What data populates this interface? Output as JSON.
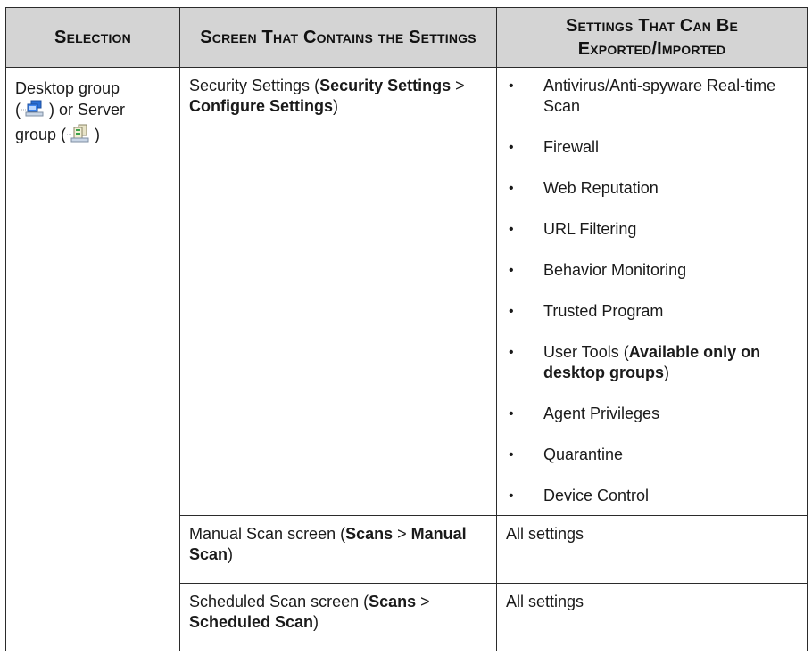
{
  "table": {
    "headers": [
      "Selection",
      "Screen That Contains the Settings",
      "Settings That Can Be Exported/Imported"
    ],
    "selection": {
      "desktop_text": "Desktop group",
      "desktop_icon": "desktop-group-icon",
      "or_server_text": ") or Server",
      "server_text": "group (",
      "server_icon": "server-group-icon",
      "close_paren": ")"
    },
    "rows": [
      {
        "screen": {
          "plain1": "Security Settings (",
          "bold1": "Security Settings",
          "sep": " > ",
          "bold2": "Configure Settings",
          "end": ")"
        },
        "settings": [
          "Antivirus/Anti-spyware Real-time Scan",
          "Firewall",
          "Web Reputation",
          "URL Filtering",
          "Behavior Monitoring",
          "Trusted Program",
          {
            "plain": "User Tools (",
            "bold": "Available only on desktop groups",
            "end": ")"
          },
          "Agent Privileges",
          "Quarantine",
          "Device Control"
        ]
      },
      {
        "screen": {
          "plain1": "Manual Scan screen (",
          "bold1": "Scans",
          "sep": " > ",
          "bold2": "Manual Scan",
          "end": ")"
        },
        "settings_text": "All settings"
      },
      {
        "screen": {
          "plain1": "Scheduled Scan screen (",
          "bold1": "Scans",
          "sep": " > ",
          "bold2": "Scheduled Scan",
          "end": ")"
        },
        "settings_text": "All settings"
      }
    ],
    "bullet_glyph": "•"
  }
}
